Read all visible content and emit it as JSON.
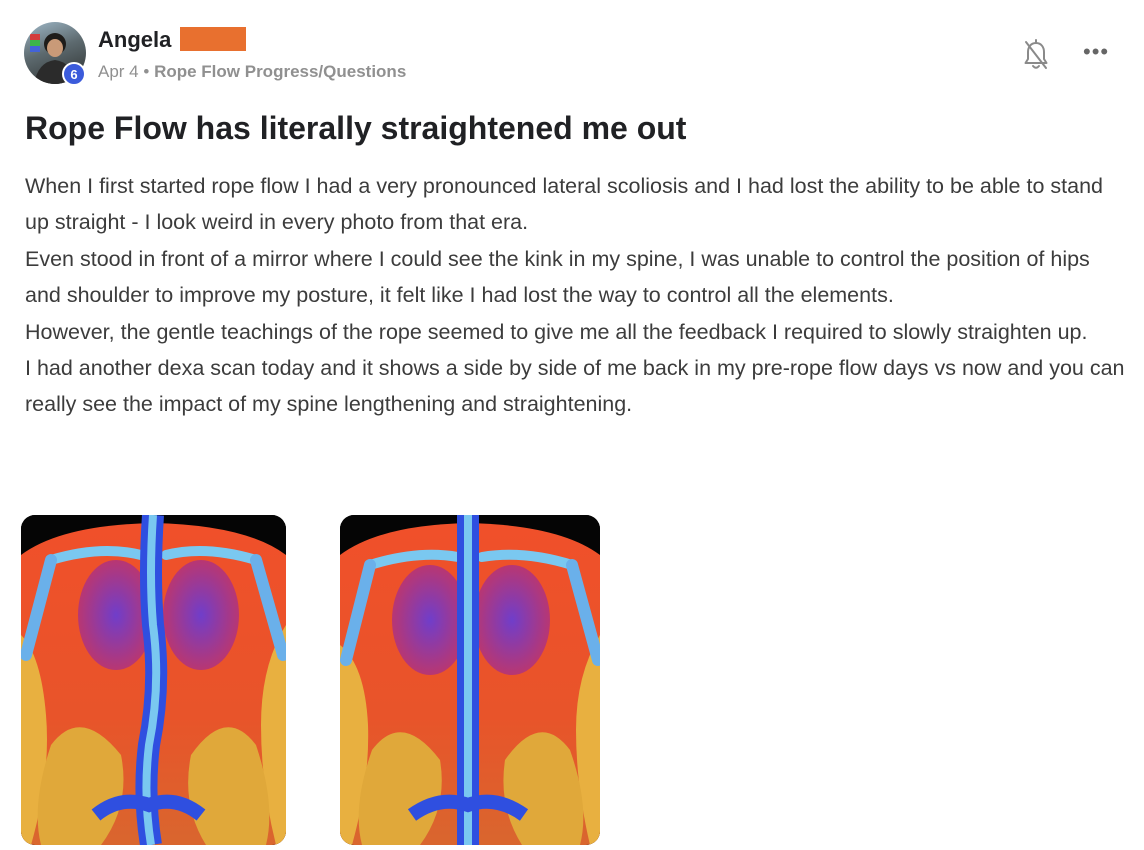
{
  "author": {
    "name": "Angela",
    "level": "6"
  },
  "meta": {
    "date": "Apr 4",
    "separator": "•",
    "category": "Rope Flow Progress/Questions"
  },
  "actions": {
    "bell_icon": "bell-off-icon",
    "more_icon": "more-horizontal-icon",
    "more_glyph": "•••"
  },
  "post": {
    "title": "Rope Flow has literally straightened me out",
    "paragraphs": [
      "When I first started rope flow I had a very pronounced lateral scoliosis and I had lost the ability to be able to stand up straight - I look weird in every photo from that era.",
      "Even stood in front of a mirror where I could see the kink in my spine, I was unable to control the position of hips and shoulder to improve my posture, it felt like I had lost the way to control all the elements.",
      "However, the gentle teachings of the rope seemed to give me all the feedback I required to slowly straighten up.",
      "I had another dexa scan today and it shows a side by side of me back in my pre-rope flow days vs now and you can really see the impact of my spine lengthening and straightening."
    ]
  },
  "colors": {
    "redaction": "#e8702f",
    "badge": "#3b5bdb",
    "scan_orange": "#e8542a",
    "scan_blue": "#2f4fe0",
    "scan_yellow": "#e8b040",
    "scan_cyan": "#7ac8f0"
  }
}
